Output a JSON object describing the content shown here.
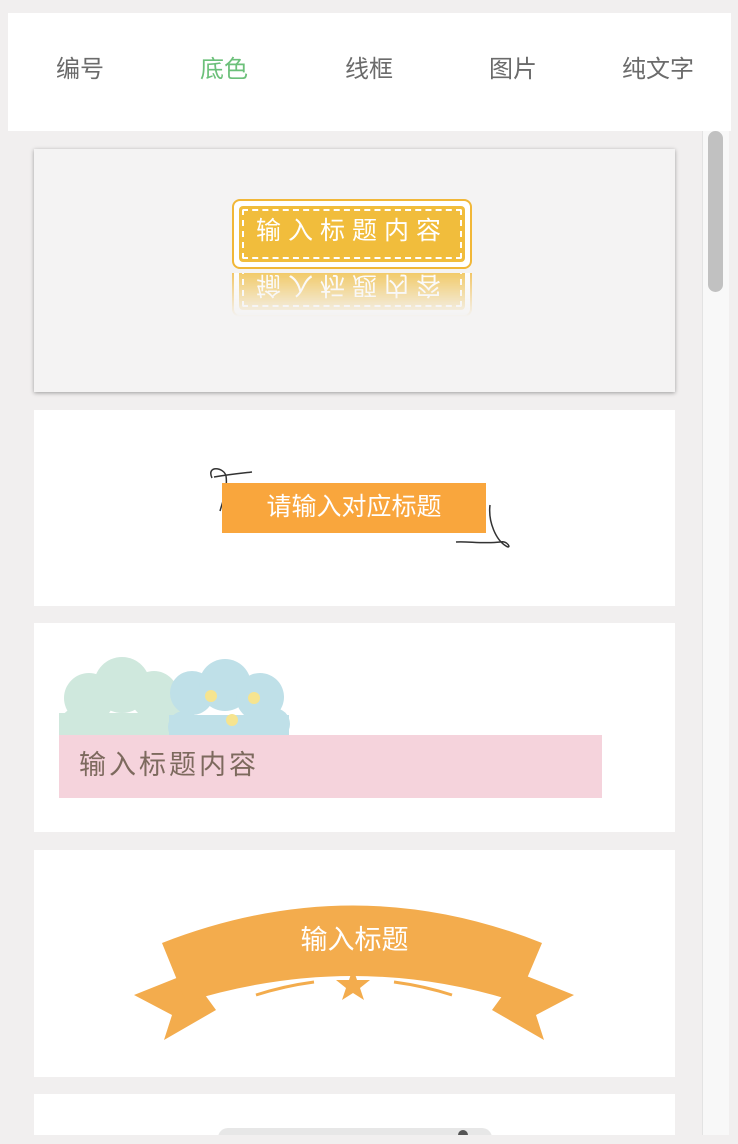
{
  "tabs": [
    {
      "label": "编号",
      "active": false
    },
    {
      "label": "底色",
      "active": true
    },
    {
      "label": "线框",
      "active": false
    },
    {
      "label": "图片",
      "active": false
    },
    {
      "label": "纯文字",
      "active": false
    }
  ],
  "templates": [
    {
      "text": "输入标题内容",
      "selected": true,
      "style": "dashed-ticket"
    },
    {
      "text": "请输入对应标题",
      "selected": false,
      "style": "orange-bar-with-scribbles"
    },
    {
      "text": "输入标题内容",
      "selected": false,
      "style": "pink-bar-with-clouds"
    },
    {
      "text": "输入标题",
      "selected": false,
      "style": "orange-ribbon-banner"
    },
    {
      "text": "",
      "selected": false,
      "style": "partially-visible"
    }
  ],
  "colors": {
    "active_tab": "#6cc07a",
    "ticket": "#f1bd3c",
    "orange": "#f9a63d",
    "ribbon": "#f3ac4d",
    "pink": "#f5d3dc"
  }
}
